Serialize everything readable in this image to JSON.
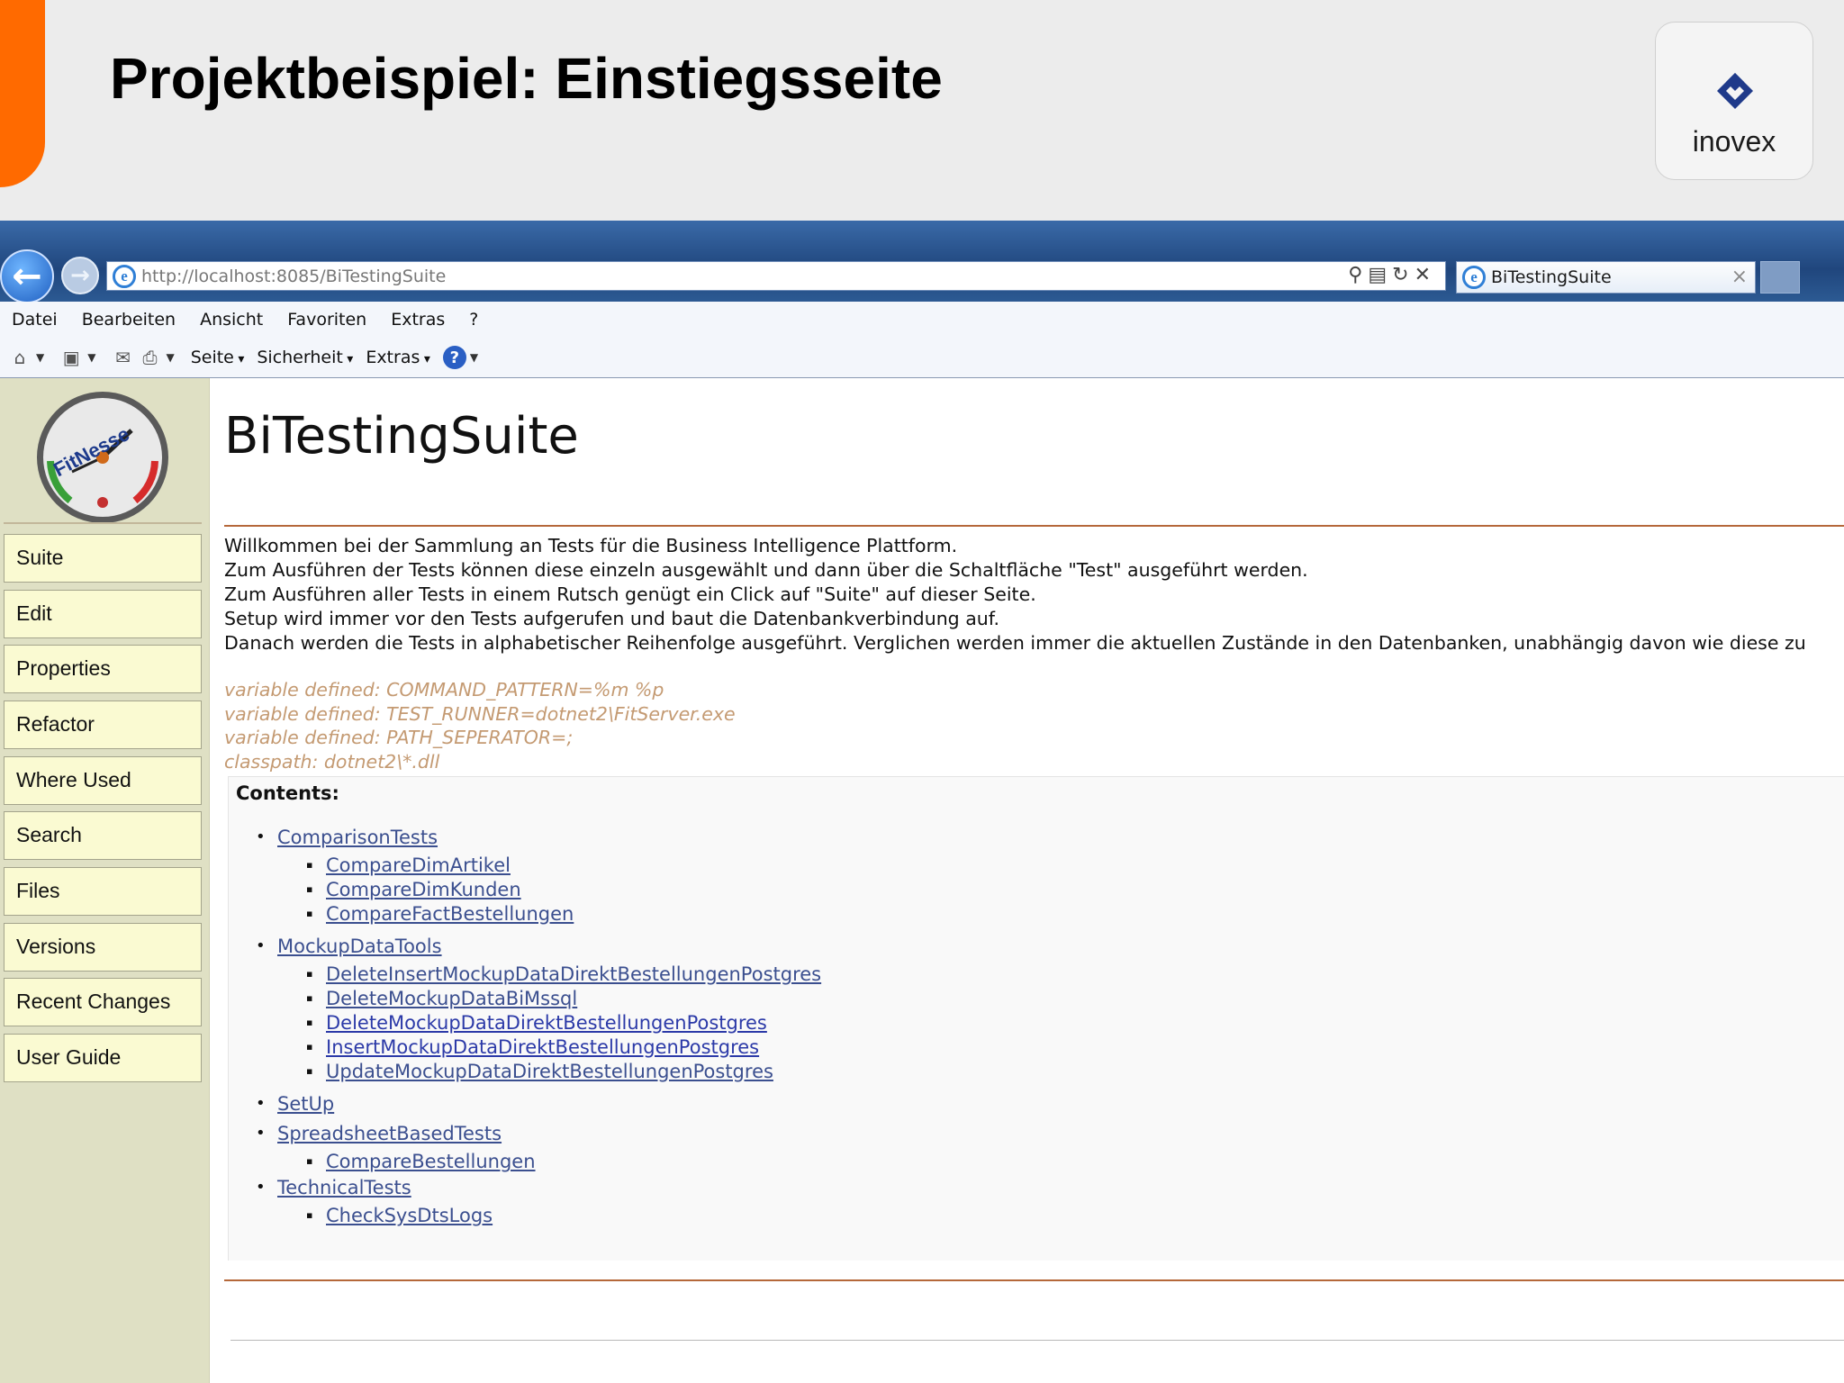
{
  "slide": {
    "title": "Projektbeispiel: Einstiegsseite",
    "logo_text": "inovex",
    "accent_color": "#ff6a00"
  },
  "browser": {
    "url": "http://localhost:8085/BiTestingSuite",
    "tab_title": "BiTestingSuite",
    "menu": [
      "Datei",
      "Bearbeiten",
      "Ansicht",
      "Favoriten",
      "Extras",
      "?"
    ],
    "commands": [
      "Seite",
      "Sicherheit",
      "Extras"
    ],
    "icons": [
      "back-icon",
      "forward-icon",
      "home-icon",
      "feeds-icon",
      "mail-icon",
      "print-icon",
      "help-icon",
      "search-icon",
      "refresh-icon",
      "stop-icon"
    ]
  },
  "fitnesse": {
    "sidebar": [
      "Suite",
      "Edit",
      "Properties",
      "Refactor",
      "Where Used",
      "Search",
      "Files",
      "Versions",
      "Recent Changes",
      "User Guide"
    ],
    "page_title": "BiTestingSuite",
    "description": [
      "Willkommen bei der Sammlung an Tests für die Business Intelligence Plattform.",
      "Zum Ausführen der Tests können diese einzeln ausgewählt und dann über die Schaltfläche \"Test\" ausgeführt werden.",
      "Zum Ausführen aller Tests in einem Rutsch genügt ein Click auf \"Suite\" auf dieser Seite.",
      "Setup wird immer vor den Tests aufgerufen und baut die Datenbankverbindung auf.",
      "Danach werden die Tests in alphabetischer Reihenfolge ausgeführt. Verglichen werden immer die aktuellen Zustände in den Datenbanken, unabhängig davon wie diese zu"
    ],
    "variables": [
      "variable defined: COMMAND_PATTERN=%m %p",
      "variable defined: TEST_RUNNER=dotnet2\\FitServer.exe",
      "variable defined: PATH_SEPERATOR=;",
      "classpath: dotnet2\\*.dll"
    ],
    "contents_label": "Contents:",
    "toc": [
      {
        "name": "ComparisonTests",
        "children": [
          "CompareDimArtikel",
          "CompareDimKunden",
          "CompareFactBestellungen"
        ]
      },
      {
        "name": "MockupDataTools",
        "children": [
          "DeleteInsertMockupDataDirektBestellungenPostgres",
          "DeleteMockupDataBiMssql",
          "DeleteMockupDataDirektBestellungenPostgres",
          "InsertMockupDataDirektBestellungenPostgres",
          "UpdateMockupDataDirektBestellungenPostgres"
        ]
      },
      {
        "name": "SetUp",
        "children": []
      },
      {
        "name": "SpreadsheetBasedTests",
        "children": [
          "CompareBestellungen"
        ]
      },
      {
        "name": "TechnicalTests",
        "children": [
          "CheckSysDtsLogs"
        ]
      }
    ]
  }
}
